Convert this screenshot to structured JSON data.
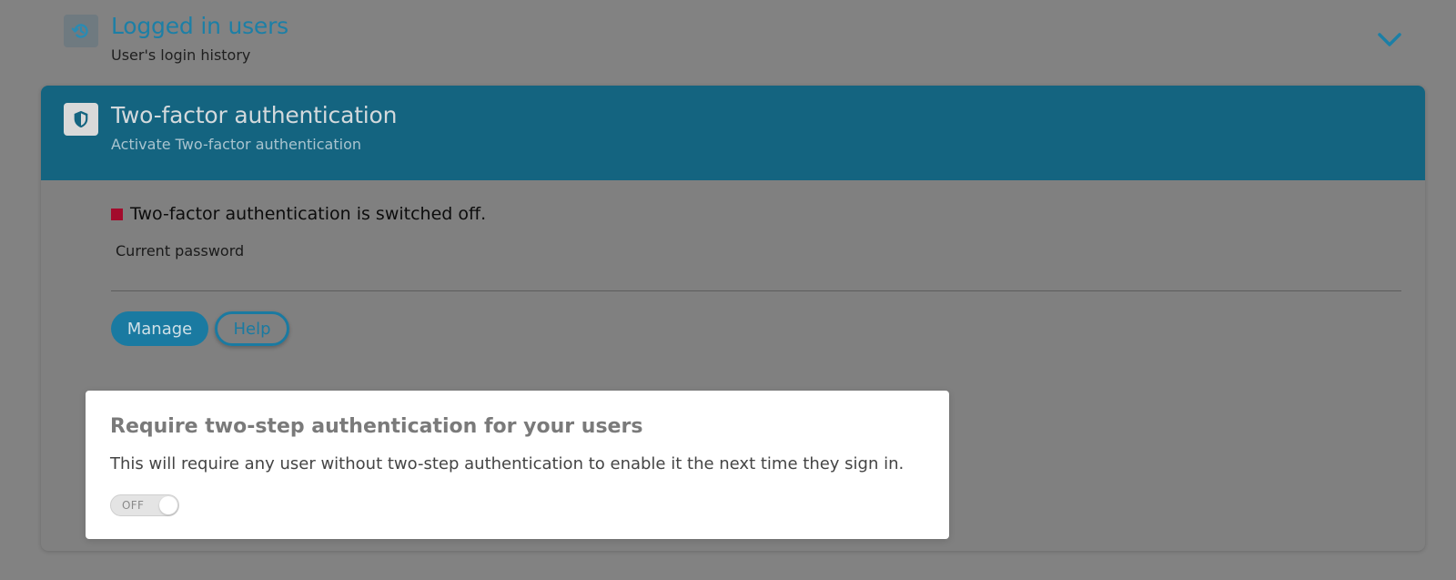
{
  "logged_users": {
    "title": "Logged in users",
    "subtitle": "User's login history",
    "icon": "history-icon",
    "expand_icon": "chevron-down-icon"
  },
  "two_factor": {
    "title": "Two-factor authentication",
    "subtitle": "Activate Two-factor authentication",
    "icon": "shield-icon",
    "status_text": "Two-factor authentication is switched off.",
    "status_color": "#a30b2c",
    "password_label": "Current password",
    "password_value": "",
    "manage_label": "Manage",
    "help_label": "Help"
  },
  "popup": {
    "title": "Require two-step authentication for your users",
    "description": "This will require any user without two-step authentication to enable it the next time they sign in.",
    "toggle_label": "OFF",
    "toggle_state": "off"
  },
  "colors": {
    "accent": "#1a7aa1",
    "header_bg": "#146480",
    "overlay_bg": "#828282"
  }
}
